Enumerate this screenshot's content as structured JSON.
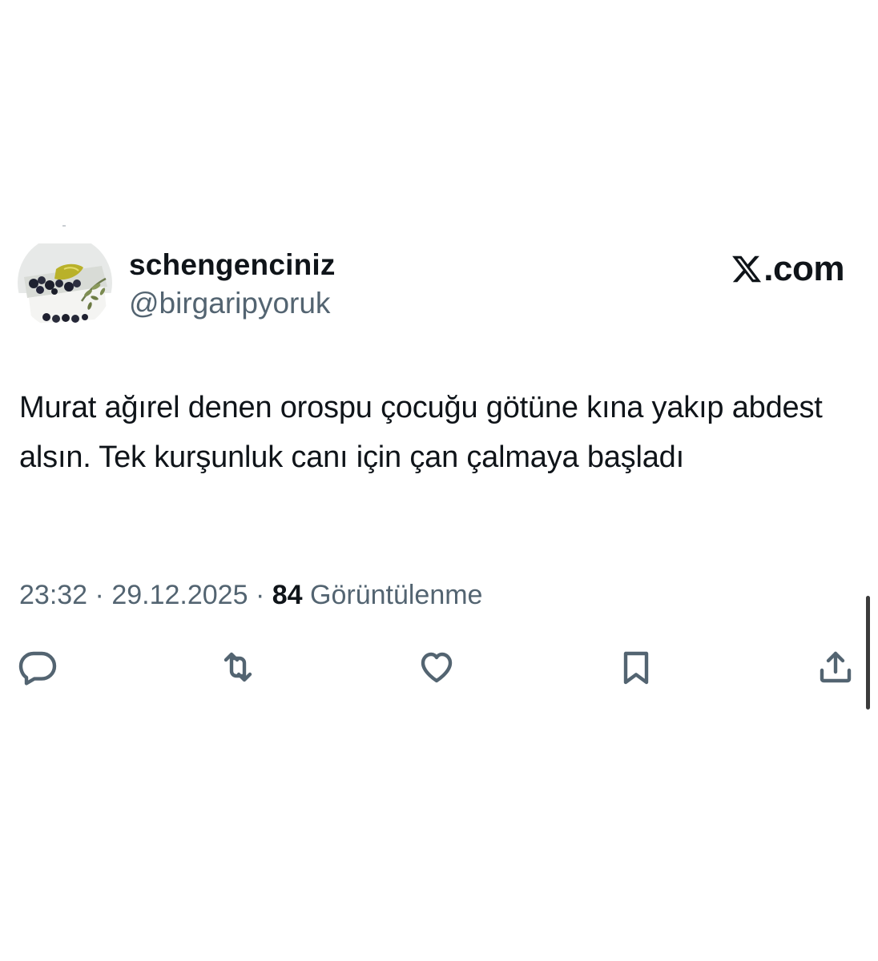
{
  "user": {
    "display_name": "schengenciniz",
    "handle": "@birgaripyoruk"
  },
  "brand": {
    "logo_icon": "x-logo-icon",
    "text": ".com"
  },
  "tweet": {
    "text": "Murat ağırel denen orospu çocuğu götüne kına yakıp abdest alsın. Tek kurşunluk canı için çan çalmaya başladı",
    "time": "23:32",
    "separator": "·",
    "date": "29.12.2025",
    "views": "84",
    "views_label": "Görüntülenme"
  },
  "actions": [
    {
      "icon": "reply-icon"
    },
    {
      "icon": "repost-icon"
    },
    {
      "icon": "like-icon"
    },
    {
      "icon": "bookmark-icon"
    },
    {
      "icon": "share-icon"
    }
  ],
  "colors": {
    "text_primary": "#0f1419",
    "text_secondary": "#536471",
    "background": "#ffffff"
  }
}
